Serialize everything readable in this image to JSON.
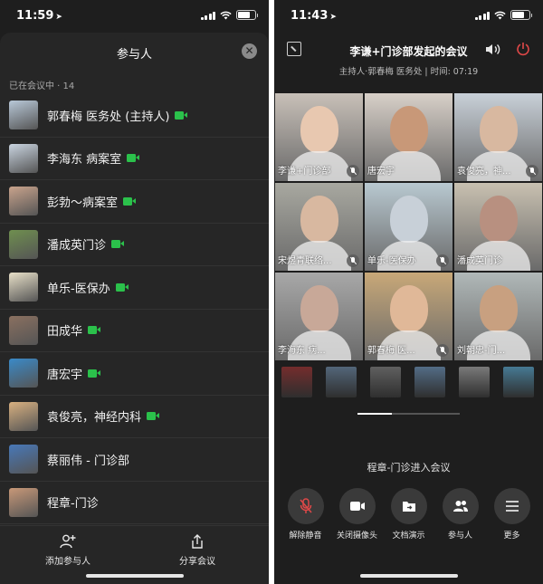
{
  "left": {
    "status": {
      "time": "11:59"
    },
    "sheet_title": "参与人",
    "in_meeting": "已在会议中 · 14",
    "participants": [
      {
        "name": "郭春梅 医务处 (主持人)",
        "video": true,
        "avatar_color": "#b8c8d8"
      },
      {
        "name": "李海东  病案室",
        "video": true,
        "avatar_color": "#c9d4e0"
      },
      {
        "name": "彭勃～病案室",
        "video": true,
        "avatar_color": "#c9a38c"
      },
      {
        "name": "潘成英门诊",
        "video": true,
        "avatar_color": "#6f8f4f"
      },
      {
        "name": "单乐-医保办",
        "video": true,
        "avatar_color": "#e8e0c8"
      },
      {
        "name": "田成华",
        "video": true,
        "avatar_color": "#8a7060"
      },
      {
        "name": "唐宏宇",
        "video": true,
        "avatar_color": "#3a8ac8"
      },
      {
        "name": "袁俊亮，神经内科",
        "video": true,
        "avatar_color": "#d8b080"
      },
      {
        "name": "蔡丽伟 - 门诊部",
        "video": false,
        "avatar_color": "#4878b8"
      },
      {
        "name": "程章-门诊",
        "video": false,
        "avatar_color": "#c89878"
      }
    ],
    "bottom": {
      "add_label": "添加参与人",
      "share_label": "分享会议"
    }
  },
  "right": {
    "status": {
      "time": "11:43"
    },
    "meeting_title": "李谦+门诊部发起的会议",
    "subtitle": "主持人·郭春梅 医务处 | 时间: 07:19",
    "tiles": [
      {
        "label": "李谦+门诊部",
        "bg": "#c8c0b8",
        "face": "#e8c8b0",
        "muted": true
      },
      {
        "label": "唐宏宇",
        "bg": "#d8d0c8",
        "face": "#c89878",
        "muted": false
      },
      {
        "label": "袁俊亮，神...",
        "bg": "#c8d0d8",
        "face": "#d8b8a0",
        "muted": true
      },
      {
        "label": "宋煜青联络...",
        "bg": "#a8a8a0",
        "face": "#d8b8a0",
        "muted": true
      },
      {
        "label": "单乐-医保办",
        "bg": "#b8c8d0",
        "face": "#c8d0d8",
        "muted": true
      },
      {
        "label": "潘成英门诊",
        "bg": "#c8c0b0",
        "face": "#b89080",
        "muted": false
      },
      {
        "label": "李海东  病...",
        "bg": "#a8a8a8",
        "face": "#c8a898",
        "muted": false
      },
      {
        "label": "郭春梅 医...",
        "bg": "#c8a878",
        "face": "#e0b898",
        "muted": true
      },
      {
        "label": "刘朝忠-门...",
        "bg": "#b0b8b8",
        "face": "#c8a080",
        "muted": false
      }
    ],
    "thumbs": [
      "#8a3030",
      "#607890",
      "#707070",
      "#6080a0",
      "#909090",
      "#5090b0"
    ],
    "notice": "程章-门诊进入会议",
    "controls": [
      {
        "label": "解除静音",
        "icon": "mic-off-icon"
      },
      {
        "label": "关闭摄像头",
        "icon": "camera-icon"
      },
      {
        "label": "文档演示",
        "icon": "share-screen-icon"
      },
      {
        "label": "参与人",
        "icon": "participants-icon"
      },
      {
        "label": "更多",
        "icon": "more-icon"
      }
    ]
  },
  "colors": {
    "accent_green": "#2bc14b",
    "power_red": "#e04848"
  }
}
